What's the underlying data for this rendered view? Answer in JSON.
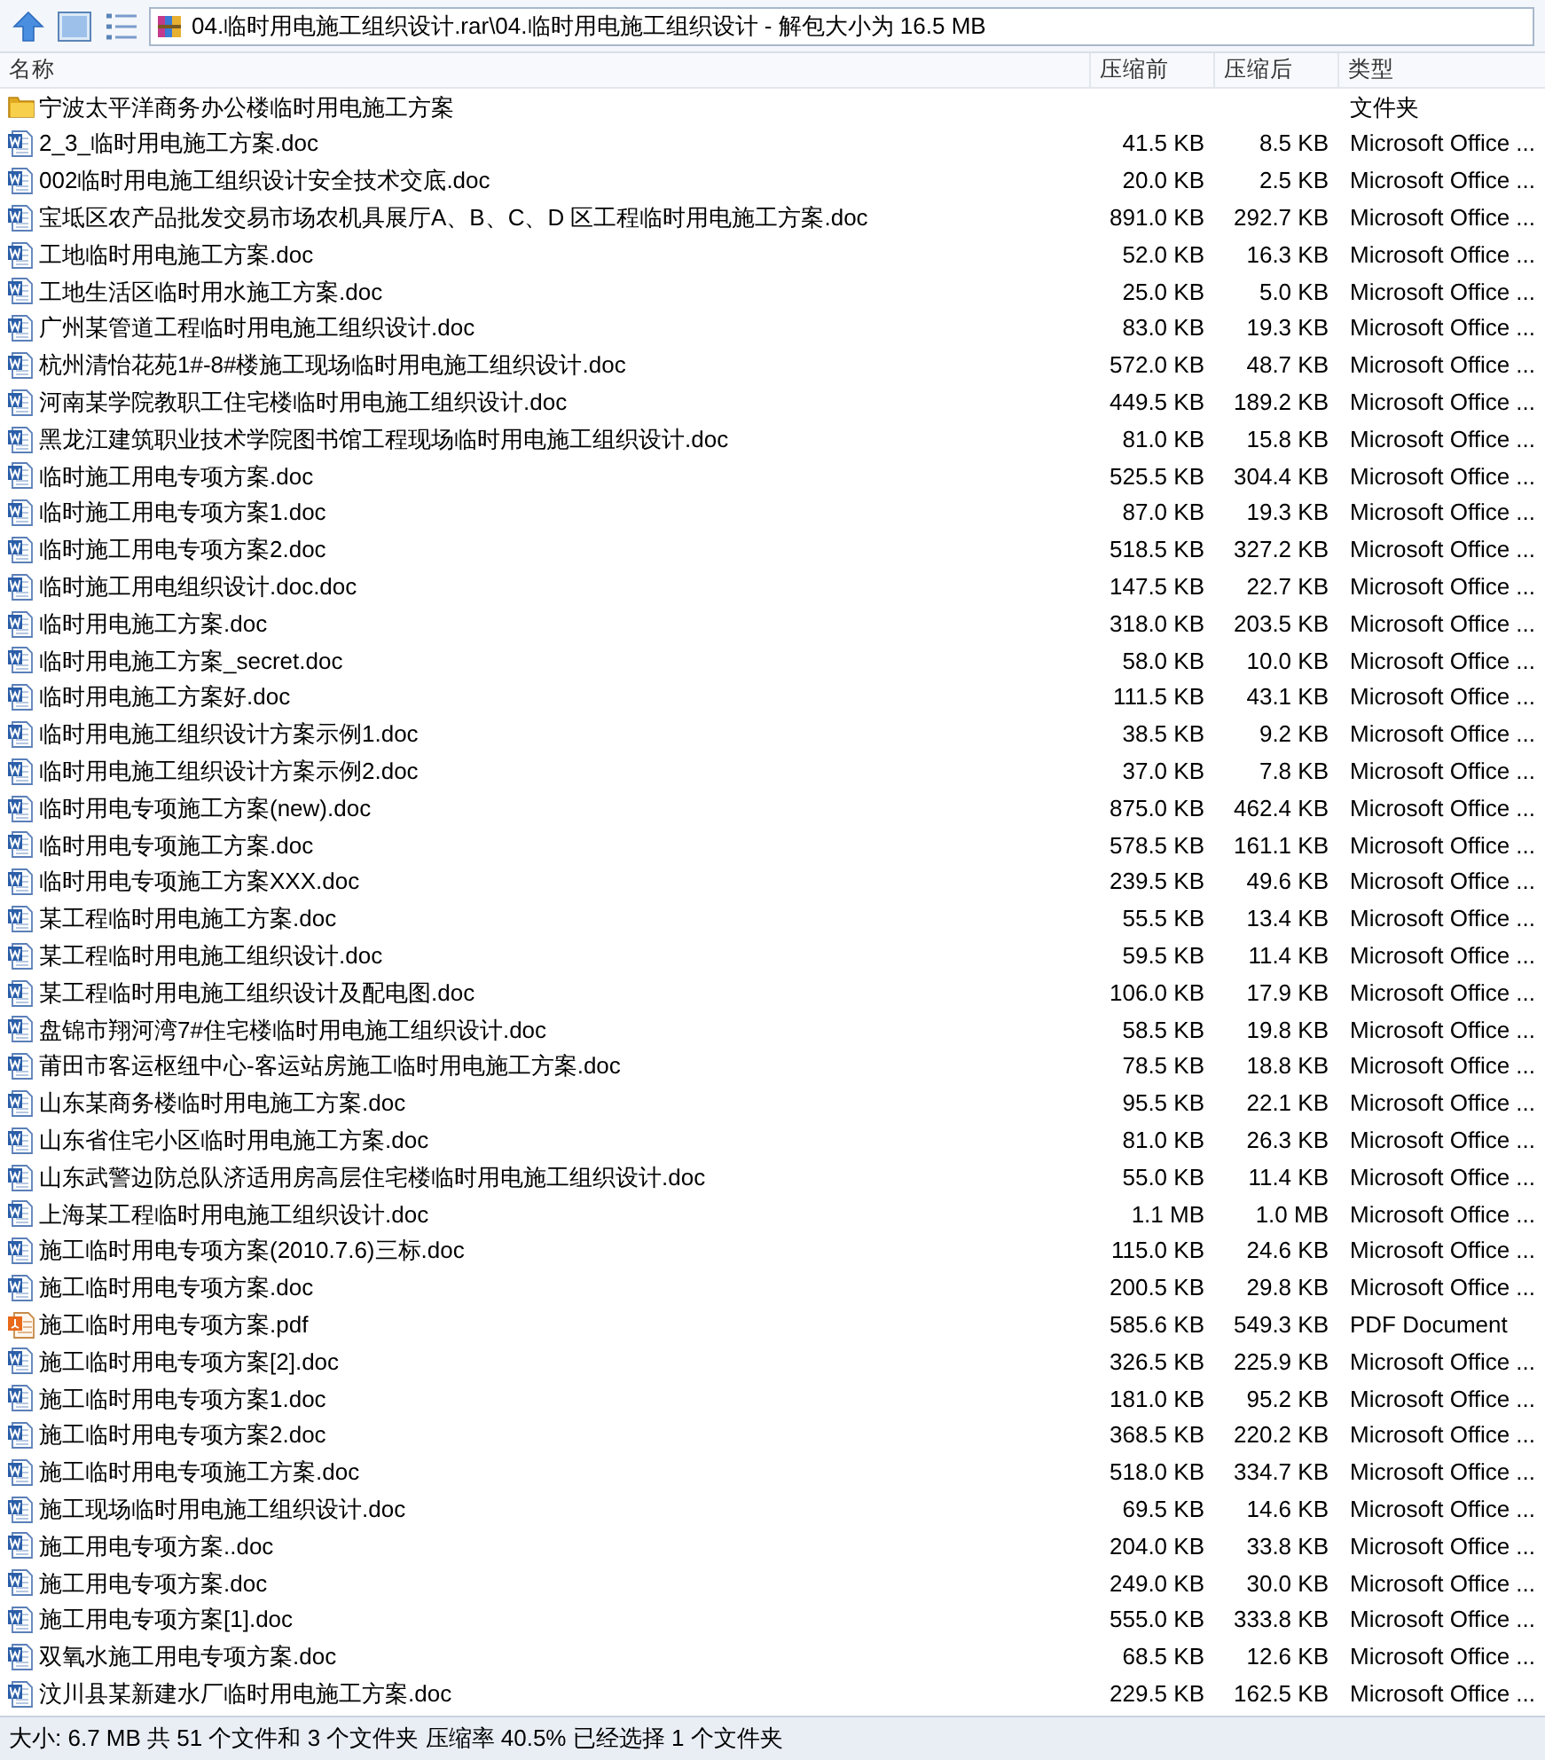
{
  "address_bar": {
    "path": "04.临时用电施工组织设计.rar\\04.临时用电施工组织设计 - 解包大小为 16.5 MB"
  },
  "table": {
    "columns": [
      "名称",
      "压缩前",
      "压缩后",
      "类型"
    ],
    "rows": [
      {
        "kind": "folder",
        "name": "宁波太平洋商务办公楼临时用电施工方案",
        "type": "文件夹"
      },
      {
        "kind": "doc",
        "name": "2_3_临时用电施工方案.doc",
        "size": "41.5 KB",
        "packed": "8.5 KB",
        "type": "Microsoft Office ..."
      },
      {
        "kind": "doc",
        "name": "002临时用电施工组织设计安全技术交底.doc",
        "size": "20.0 KB",
        "packed": "2.5 KB",
        "type": "Microsoft Office ..."
      },
      {
        "kind": "doc",
        "name": "宝坻区农产品批发交易市场农机具展厅A、B、C、D 区工程临时用电施工方案.doc",
        "size": "891.0 KB",
        "packed": "292.7 KB",
        "type": "Microsoft Office ..."
      },
      {
        "kind": "doc",
        "name": "工地临时用电施工方案.doc",
        "size": "52.0 KB",
        "packed": "16.3 KB",
        "type": "Microsoft Office ..."
      },
      {
        "kind": "doc",
        "name": "工地生活区临时用水施工方案.doc",
        "size": "25.0 KB",
        "packed": "5.0 KB",
        "type": "Microsoft Office ..."
      },
      {
        "kind": "doc",
        "name": "广州某管道工程临时用电施工组织设计.doc",
        "size": "83.0 KB",
        "packed": "19.3 KB",
        "type": "Microsoft Office ..."
      },
      {
        "kind": "doc",
        "name": "杭州清怡花苑1#-8#楼施工现场临时用电施工组织设计.doc",
        "size": "572.0 KB",
        "packed": "48.7 KB",
        "type": "Microsoft Office ..."
      },
      {
        "kind": "doc",
        "name": "河南某学院教职工住宅楼临时用电施工组织设计.doc",
        "size": "449.5 KB",
        "packed": "189.2 KB",
        "type": "Microsoft Office ..."
      },
      {
        "kind": "doc",
        "name": "黑龙江建筑职业技术学院图书馆工程现场临时用电施工组织设计.doc",
        "size": "81.0 KB",
        "packed": "15.8 KB",
        "type": "Microsoft Office ..."
      },
      {
        "kind": "doc",
        "name": "临时施工用电专项方案.doc",
        "size": "525.5 KB",
        "packed": "304.4 KB",
        "type": "Microsoft Office ..."
      },
      {
        "kind": "doc",
        "name": "临时施工用电专项方案1.doc",
        "size": "87.0 KB",
        "packed": "19.3 KB",
        "type": "Microsoft Office ..."
      },
      {
        "kind": "doc",
        "name": "临时施工用电专项方案2.doc",
        "size": "518.5 KB",
        "packed": "327.2 KB",
        "type": "Microsoft Office ..."
      },
      {
        "kind": "doc",
        "name": "临时施工用电组织设计.doc.doc",
        "size": "147.5 KB",
        "packed": "22.7 KB",
        "type": "Microsoft Office ..."
      },
      {
        "kind": "doc",
        "name": "临时用电施工方案.doc",
        "size": "318.0 KB",
        "packed": "203.5 KB",
        "type": "Microsoft Office ..."
      },
      {
        "kind": "doc",
        "name": "临时用电施工方案_secret.doc",
        "size": "58.0 KB",
        "packed": "10.0 KB",
        "type": "Microsoft Office ..."
      },
      {
        "kind": "doc",
        "name": "临时用电施工方案好.doc",
        "size": "111.5 KB",
        "packed": "43.1 KB",
        "type": "Microsoft Office ..."
      },
      {
        "kind": "doc",
        "name": "临时用电施工组织设计方案示例1.doc",
        "size": "38.5 KB",
        "packed": "9.2 KB",
        "type": "Microsoft Office ..."
      },
      {
        "kind": "doc",
        "name": "临时用电施工组织设计方案示例2.doc",
        "size": "37.0 KB",
        "packed": "7.8 KB",
        "type": "Microsoft Office ..."
      },
      {
        "kind": "doc",
        "name": "临时用电专项施工方案(new).doc",
        "size": "875.0 KB",
        "packed": "462.4 KB",
        "type": "Microsoft Office ..."
      },
      {
        "kind": "doc",
        "name": "临时用电专项施工方案.doc",
        "size": "578.5 KB",
        "packed": "161.1 KB",
        "type": "Microsoft Office ..."
      },
      {
        "kind": "doc",
        "name": "临时用电专项施工方案XXX.doc",
        "size": "239.5 KB",
        "packed": "49.6 KB",
        "type": "Microsoft Office ..."
      },
      {
        "kind": "doc",
        "name": "某工程临时用电施工方案.doc",
        "size": "55.5 KB",
        "packed": "13.4 KB",
        "type": "Microsoft Office ..."
      },
      {
        "kind": "doc",
        "name": "某工程临时用电施工组织设计.doc",
        "size": "59.5 KB",
        "packed": "11.4 KB",
        "type": "Microsoft Office ..."
      },
      {
        "kind": "doc",
        "name": "某工程临时用电施工组织设计及配电图.doc",
        "size": "106.0 KB",
        "packed": "17.9 KB",
        "type": "Microsoft Office ..."
      },
      {
        "kind": "doc",
        "name": "盘锦市翔河湾7#住宅楼临时用电施工组织设计.doc",
        "size": "58.5 KB",
        "packed": "19.8 KB",
        "type": "Microsoft Office ..."
      },
      {
        "kind": "doc",
        "name": "莆田市客运枢纽中心-客运站房施工临时用电施工方案.doc",
        "size": "78.5 KB",
        "packed": "18.8 KB",
        "type": "Microsoft Office ..."
      },
      {
        "kind": "doc",
        "name": "山东某商务楼临时用电施工方案.doc",
        "size": "95.5 KB",
        "packed": "22.1 KB",
        "type": "Microsoft Office ..."
      },
      {
        "kind": "doc",
        "name": "山东省住宅小区临时用电施工方案.doc",
        "size": "81.0 KB",
        "packed": "26.3 KB",
        "type": "Microsoft Office ..."
      },
      {
        "kind": "doc",
        "name": "山东武警边防总队济适用房高层住宅楼临时用电施工组织设计.doc",
        "size": "55.0 KB",
        "packed": "11.4 KB",
        "type": "Microsoft Office ..."
      },
      {
        "kind": "doc",
        "name": "上海某工程临时用电施工组织设计.doc",
        "size": "1.1 MB",
        "packed": "1.0 MB",
        "type": "Microsoft Office ..."
      },
      {
        "kind": "doc",
        "name": "施工临时用电专项方案(2010.7.6)三标.doc",
        "size": "115.0 KB",
        "packed": "24.6 KB",
        "type": "Microsoft Office ..."
      },
      {
        "kind": "doc",
        "name": "施工临时用电专项方案.doc",
        "size": "200.5 KB",
        "packed": "29.8 KB",
        "type": "Microsoft Office ..."
      },
      {
        "kind": "pdf",
        "name": "施工临时用电专项方案.pdf",
        "size": "585.6 KB",
        "packed": "549.3 KB",
        "type": "PDF Document"
      },
      {
        "kind": "doc",
        "name": "施工临时用电专项方案[2].doc",
        "size": "326.5 KB",
        "packed": "225.9 KB",
        "type": "Microsoft Office ..."
      },
      {
        "kind": "doc",
        "name": "施工临时用电专项方案1.doc",
        "size": "181.0 KB",
        "packed": "95.2 KB",
        "type": "Microsoft Office ..."
      },
      {
        "kind": "doc",
        "name": "施工临时用电专项方案2.doc",
        "size": "368.5 KB",
        "packed": "220.2 KB",
        "type": "Microsoft Office ..."
      },
      {
        "kind": "doc",
        "name": "施工临时用电专项施工方案.doc",
        "size": "518.0 KB",
        "packed": "334.7 KB",
        "type": "Microsoft Office ..."
      },
      {
        "kind": "doc",
        "name": "施工现场临时用电施工组织设计.doc",
        "size": "69.5 KB",
        "packed": "14.6 KB",
        "type": "Microsoft Office ..."
      },
      {
        "kind": "doc",
        "name": "施工用电专项方案..doc",
        "size": "204.0 KB",
        "packed": "33.8 KB",
        "type": "Microsoft Office ..."
      },
      {
        "kind": "doc",
        "name": "施工用电专项方案.doc",
        "size": "249.0 KB",
        "packed": "30.0 KB",
        "type": "Microsoft Office ..."
      },
      {
        "kind": "doc",
        "name": "施工用电专项方案[1].doc",
        "size": "555.0 KB",
        "packed": "333.8 KB",
        "type": "Microsoft Office ..."
      },
      {
        "kind": "doc",
        "name": "双氧水施工用电专项方案.doc",
        "size": "68.5 KB",
        "packed": "12.6 KB",
        "type": "Microsoft Office ..."
      },
      {
        "kind": "doc",
        "name": "汶川县某新建水厂临时用电施工方案.doc",
        "size": "229.5 KB",
        "packed": "162.5 KB",
        "type": "Microsoft Office ..."
      }
    ]
  },
  "status_bar": {
    "text": "大小: 6.7 MB 共 51 个文件和 3 个文件夹 压缩率 40.5% 已经选择 1 个文件夹"
  }
}
